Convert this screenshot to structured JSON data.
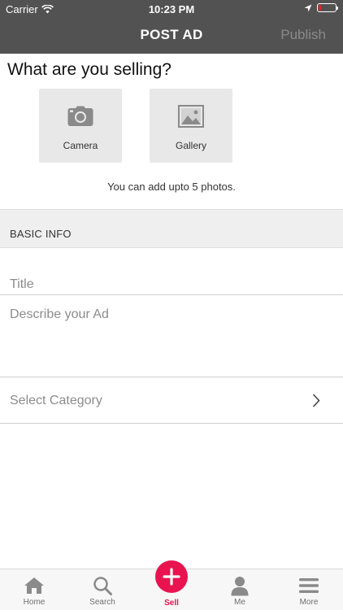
{
  "status_bar": {
    "carrier": "Carrier",
    "time": "10:23 PM",
    "battery_level": 0.15,
    "battery_color": "#e0242e"
  },
  "header": {
    "title": "POST AD",
    "publish_label": "Publish",
    "background": "#525252"
  },
  "photos": {
    "question": "What are you selling?",
    "camera_label": "Camera",
    "camera_icon": "camera-icon",
    "gallery_label": "Gallery",
    "gallery_icon": "image-icon",
    "hint": "You can add upto 5 photos."
  },
  "basic_info": {
    "section_label": "BASIC INFO",
    "title_placeholder": "Title",
    "description_placeholder": "Describe your Ad",
    "category_placeholder": "Select Category"
  },
  "tab_bar": {
    "accent": "#e8134f",
    "items": [
      {
        "label": "Home",
        "icon": "home-icon"
      },
      {
        "label": "Search",
        "icon": "search-icon"
      },
      {
        "label": "Sell",
        "icon": "plus-icon",
        "active": true
      },
      {
        "label": "Me",
        "icon": "person-icon"
      },
      {
        "label": "More",
        "icon": "menu-icon"
      }
    ]
  }
}
